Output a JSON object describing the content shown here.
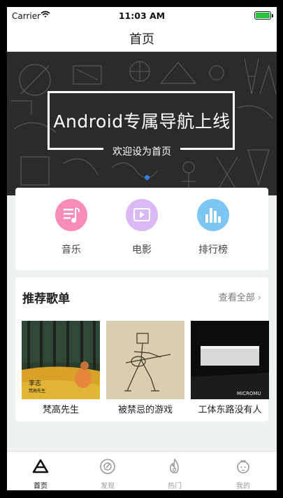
{
  "status_bar": {
    "carrier": "Carrier",
    "time": "11:03 AM"
  },
  "navbar": {
    "title": "首页"
  },
  "banner": {
    "headline": "Android专属导航上线",
    "subtitle": "欢迎设为首页"
  },
  "quick_menu": [
    {
      "label": "音乐",
      "icon": "music-note-icon",
      "color": "#f58db6"
    },
    {
      "label": "电影",
      "icon": "play-video-icon",
      "color": "#d9b8f3"
    },
    {
      "label": "排行榜",
      "icon": "bar-chart-icon",
      "color": "#7cc6f3"
    }
  ],
  "recommend": {
    "title": "推荐歌单",
    "more": "查看全部",
    "albums": [
      {
        "name": "梵高先生",
        "cover_text": "李志",
        "cover_subtext": "梵高先生"
      },
      {
        "name": "被禁忌的游戏",
        "cover_text": "",
        "cover_subtext": ""
      },
      {
        "name": "工体东路没有人",
        "cover_text": "MICROMU",
        "cover_subtext": ""
      }
    ]
  },
  "tabbar": [
    {
      "label": "首页",
      "icon": "triangle-home-icon",
      "active": true
    },
    {
      "label": "发现",
      "icon": "disc-discover-icon",
      "active": false
    },
    {
      "label": "热门",
      "icon": "flame-hot-icon",
      "active": false
    },
    {
      "label": "我的",
      "icon": "profile-mine-icon",
      "active": false
    }
  ],
  "colors": {
    "accent": "#2f7fe0",
    "battery": "#29c23d"
  }
}
